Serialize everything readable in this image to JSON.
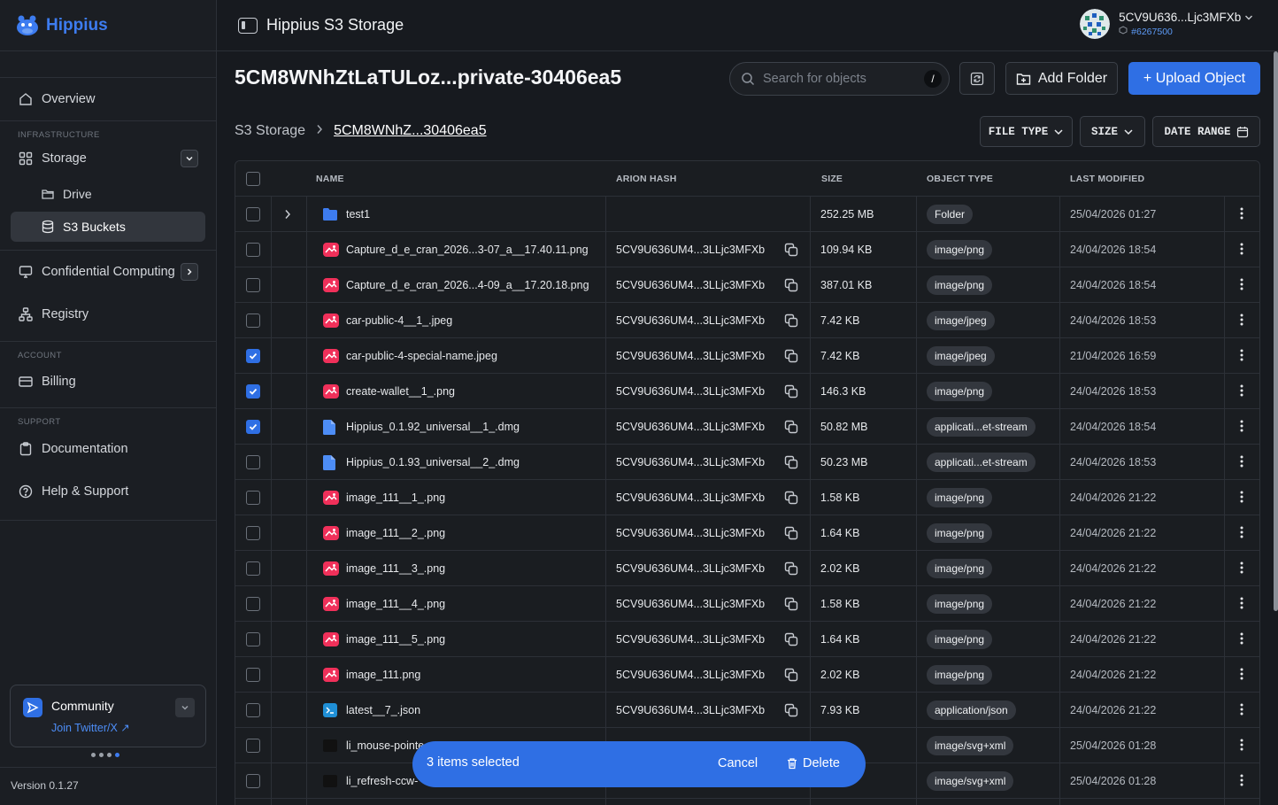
{
  "brand": {
    "name": "Hippius"
  },
  "sidebar": {
    "overview": "Overview",
    "infrastructure_caption": "INFRASTRUCTURE",
    "storage": "Storage",
    "drive": "Drive",
    "s3_buckets": "S3 Buckets",
    "confidential": "Confidential Computing",
    "registry": "Registry",
    "account_caption": "ACCOUNT",
    "billing": "Billing",
    "support_caption": "SUPPORT",
    "documentation": "Documentation",
    "help": "Help & Support",
    "community_title": "Community",
    "community_link": "Join Twitter/X",
    "version": "Version 0.1.27"
  },
  "topbar": {
    "title": "Hippius S3 Storage",
    "account_name": "5CV9U636...Ljc3MFXb",
    "account_block": "#6267500"
  },
  "header": {
    "bucket_title": "5CM8WNhZtLaTULoz...private-30406ea5",
    "search_placeholder": "Search for objects",
    "search_shortcut": "/",
    "add_folder": "Add Folder",
    "upload": "+ Upload Object"
  },
  "breadcrumb": {
    "root": "S3 Storage",
    "current": "5CM8WNhZ...30406ea5"
  },
  "filters": {
    "file_type": "FILE TYPE",
    "size": "SIZE",
    "date_range": "DATE RANGE"
  },
  "table": {
    "columns": {
      "name": "NAME",
      "hash": "ARION HASH",
      "size": "SIZE",
      "type": "OBJECT TYPE",
      "modified": "LAST MODIFIED"
    },
    "rows": [
      {
        "name": "test1",
        "hash": "",
        "size": "252.25 MB",
        "type": "Folder",
        "modified": "25/04/2026 01:27",
        "icon": "folder-icon",
        "checked": false,
        "folder": true
      },
      {
        "name": "Capture_d_e_cran_2026...3-07_a__17.40.11.png",
        "hash": "5CV9U636UM4...3LLjc3MFXb",
        "size": "109.94 KB",
        "type": "image/png",
        "modified": "24/04/2026 18:54",
        "icon": "image-icon",
        "checked": false
      },
      {
        "name": "Capture_d_e_cran_2026...4-09_a__17.20.18.png",
        "hash": "5CV9U636UM4...3LLjc3MFXb",
        "size": "387.01 KB",
        "type": "image/png",
        "modified": "24/04/2026 18:54",
        "icon": "image-icon",
        "checked": false
      },
      {
        "name": "car-public-4__1_.jpeg",
        "hash": "5CV9U636UM4...3LLjc3MFXb",
        "size": "7.42 KB",
        "type": "image/jpeg",
        "modified": "24/04/2026 18:53",
        "icon": "image-icon",
        "checked": false
      },
      {
        "name": "car-public-4-special-name.jpeg",
        "hash": "5CV9U636UM4...3LLjc3MFXb",
        "size": "7.42 KB",
        "type": "image/jpeg",
        "modified": "21/04/2026 16:59",
        "icon": "image-icon",
        "checked": true
      },
      {
        "name": "create-wallet__1_.png",
        "hash": "5CV9U636UM4...3LLjc3MFXb",
        "size": "146.3 KB",
        "type": "image/png",
        "modified": "24/04/2026 18:53",
        "icon": "image-icon",
        "checked": true
      },
      {
        "name": "Hippius_0.1.92_universal__1_.dmg",
        "hash": "5CV9U636UM4...3LLjc3MFXb",
        "size": "50.82 MB",
        "type": "applicati...et-stream",
        "modified": "24/04/2026 18:54",
        "icon": "file-icon",
        "checked": true
      },
      {
        "name": "Hippius_0.1.93_universal__2_.dmg",
        "hash": "5CV9U636UM4...3LLjc3MFXb",
        "size": "50.23 MB",
        "type": "applicati...et-stream",
        "modified": "24/04/2026 18:53",
        "icon": "file-icon",
        "checked": false
      },
      {
        "name": "image_111__1_.png",
        "hash": "5CV9U636UM4...3LLjc3MFXb",
        "size": "1.58 KB",
        "type": "image/png",
        "modified": "24/04/2026 21:22",
        "icon": "image-icon",
        "checked": false
      },
      {
        "name": "image_111__2_.png",
        "hash": "5CV9U636UM4...3LLjc3MFXb",
        "size": "1.64 KB",
        "type": "image/png",
        "modified": "24/04/2026 21:22",
        "icon": "image-icon",
        "checked": false
      },
      {
        "name": "image_111__3_.png",
        "hash": "5CV9U636UM4...3LLjc3MFXb",
        "size": "2.02 KB",
        "type": "image/png",
        "modified": "24/04/2026 21:22",
        "icon": "image-icon",
        "checked": false
      },
      {
        "name": "image_111__4_.png",
        "hash": "5CV9U636UM4...3LLjc3MFXb",
        "size": "1.58 KB",
        "type": "image/png",
        "modified": "24/04/2026 21:22",
        "icon": "image-icon",
        "checked": false
      },
      {
        "name": "image_111__5_.png",
        "hash": "5CV9U636UM4...3LLjc3MFXb",
        "size": "1.64 KB",
        "type": "image/png",
        "modified": "24/04/2026 21:22",
        "icon": "image-icon",
        "checked": false
      },
      {
        "name": "image_111.png",
        "hash": "5CV9U636UM4...3LLjc3MFXb",
        "size": "2.02 KB",
        "type": "image/png",
        "modified": "24/04/2026 21:22",
        "icon": "image-icon",
        "checked": false
      },
      {
        "name": "latest__7_.json",
        "hash": "5CV9U636UM4...3LLjc3MFXb",
        "size": "7.93 KB",
        "type": "application/json",
        "modified": "24/04/2026 21:22",
        "icon": "code-icon",
        "checked": false
      },
      {
        "name": "li_mouse-pointe",
        "hash": "",
        "size": "",
        "type": "image/svg+xml",
        "modified": "25/04/2026 01:28",
        "icon": "svg-file-icon",
        "checked": false
      },
      {
        "name": "li_refresh-ccw-",
        "hash": "",
        "size": "",
        "type": "image/svg+xml",
        "modified": "25/04/2026 01:28",
        "icon": "svg-file-icon",
        "checked": false
      }
    ]
  },
  "selection": {
    "text": "3 items selected",
    "cancel": "Cancel",
    "delete": "Delete"
  },
  "colors": {
    "accent": "#2f6fe4",
    "image_icon": "#f0305a",
    "folder_icon": "#3d7cf0",
    "file_icon": "#4d8df6"
  }
}
